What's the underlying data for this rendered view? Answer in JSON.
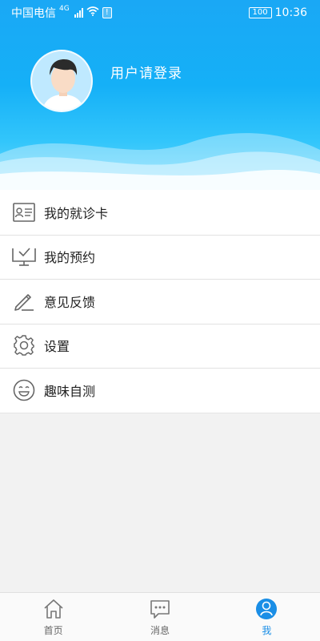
{
  "status_bar": {
    "carrier": "中国电信",
    "network": "4G",
    "battery": "100",
    "time": "10:36"
  },
  "profile": {
    "login_prompt": "用户请登录"
  },
  "menu": {
    "items": [
      {
        "label": "我的就诊卡",
        "icon": "id-card-icon"
      },
      {
        "label": "我的预约",
        "icon": "monitor-check-icon"
      },
      {
        "label": "意见反馈",
        "icon": "pencil-icon"
      },
      {
        "label": "设置",
        "icon": "gear-icon"
      },
      {
        "label": "趣味自测",
        "icon": "smile-icon"
      }
    ]
  },
  "tabbar": {
    "tabs": [
      {
        "label": "首页",
        "icon": "home-icon",
        "active": false
      },
      {
        "label": "消息",
        "icon": "message-icon",
        "active": false
      },
      {
        "label": "我",
        "icon": "user-icon",
        "active": true
      }
    ]
  },
  "colors": {
    "header_blue": "#1aa8f5",
    "accent": "#1a8ee6",
    "icon_gray": "#666666"
  }
}
